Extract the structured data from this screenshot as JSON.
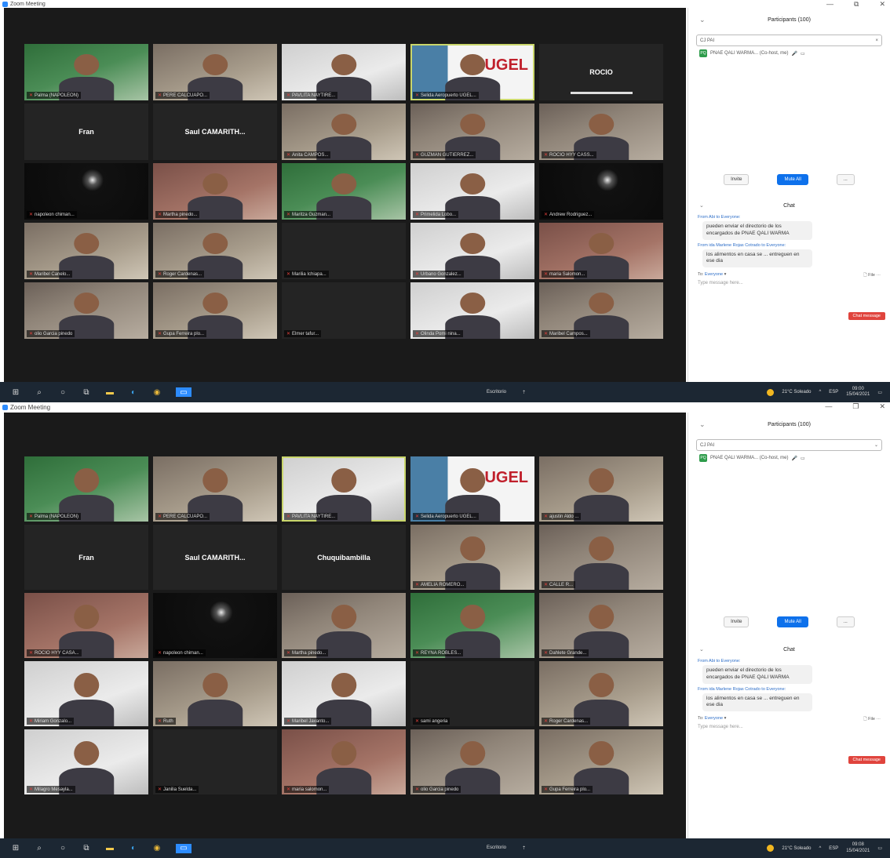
{
  "window": {
    "title": "Zoom Meeting",
    "minimize": "—",
    "maximize": "⧉",
    "restore": "❐",
    "close": "✕"
  },
  "participants_panel": {
    "title": "Participants (100)",
    "search_value": "CJ PAI",
    "entry_name": "PNAE QALI WARMA... (Co-host, me)",
    "entry_avatar": "PQ",
    "invite": "Invite",
    "mute_all": "Mute All",
    "more": "..."
  },
  "chat": {
    "title": "Chat",
    "messages": [
      {
        "from": "From Abi to Everyone:",
        "text": "pueden enviar el directorio de los encargados de PNAE QALI WARMA"
      },
      {
        "from": "From ida Marlene Rojas Cotrado to Everyone:",
        "text": "los alimentos en casa se ... entreguen en ese dia"
      }
    ],
    "warning": "Chat message",
    "to_label": "To:",
    "to_value": "Everyone",
    "file": "File",
    "placeholder": "Type message here..."
  },
  "screen1_tiles": [
    {
      "name": "Palma (NAPOLEON)"
    },
    {
      "name": "PERE CALCUAPO..."
    },
    {
      "name": "PAVLITA NAYTIRE..."
    },
    {
      "name": "Selida Aeropuerto UGEL..."
    },
    {
      "name": "ROCIO",
      "big": true
    },
    {
      "name": "Fran",
      "big": true
    },
    {
      "name": "Saul CAMARITH...",
      "big": true
    },
    {
      "name": "Anita CAMPOS..."
    },
    {
      "name": "GUZMAN GUTIERREZ..."
    },
    {
      "name": "ROCIO HYY CASS..."
    },
    {
      "name": "napoleon chiman..."
    },
    {
      "name": "Martha pinedo..."
    },
    {
      "name": "Maritza Guzman..."
    },
    {
      "name": "Primelida Lobo..."
    },
    {
      "name": "Andrew Rodriguez..."
    },
    {
      "name": "Maribel Canelo..."
    },
    {
      "name": "Roger Cardenas..."
    },
    {
      "name": "Marilia Ichiapa..."
    },
    {
      "name": "Urbano Gonzalez..."
    },
    {
      "name": "maria Salomon..."
    },
    {
      "name": "olio Garcia pinedo"
    },
    {
      "name": "Gupa Ferreira plo..."
    },
    {
      "name": "Elmer tafur..."
    },
    {
      "name": "Olinda Pomi nina..."
    },
    {
      "name": "Maribel Campos..."
    }
  ],
  "screen2_tiles": [
    {
      "name": "Palma (NAPOLEON)"
    },
    {
      "name": "PERE CALCUAPO..."
    },
    {
      "name": "PAVLITA NAYTIRE..."
    },
    {
      "name": "Selida Aeropuerto UGEL..."
    },
    {
      "name": "ajustin Aldo ..."
    },
    {
      "name": "Fran",
      "big": true
    },
    {
      "name": "Saul CAMARITH...",
      "big": true
    },
    {
      "name": "Chuquibambilla",
      "big": true
    },
    {
      "name": "AMELIA ROMERO..."
    },
    {
      "name": "CALLE R..."
    },
    {
      "name": "ROCIO HYY CASA..."
    },
    {
      "name": "napoleon chiman..."
    },
    {
      "name": "Martha pinedo..."
    },
    {
      "name": "REYNA ROBLES..."
    },
    {
      "name": "Dahlete Grande..."
    },
    {
      "name": "Miriam Gonzalo..."
    },
    {
      "name": "Ruth"
    },
    {
      "name": "Maribel Javanto..."
    },
    {
      "name": "sami angeria"
    },
    {
      "name": "Roger Cardenas..."
    },
    {
      "name": "Milagro Mesayla..."
    },
    {
      "name": "Janilia Suelda..."
    },
    {
      "name": "maria salomon..."
    },
    {
      "name": "olio Garcia pinedo"
    },
    {
      "name": "Gupa Ferreira plo..."
    }
  ],
  "taskbar": {
    "weather": "21°C Soleado",
    "notify": "Escritorio",
    "lang": "ESP",
    "time1": "09:00",
    "date1": "15/04/2021",
    "time2": "09:08",
    "date2": "15/04/2021"
  },
  "tile_labels": {
    "ugel": "UGEL"
  }
}
